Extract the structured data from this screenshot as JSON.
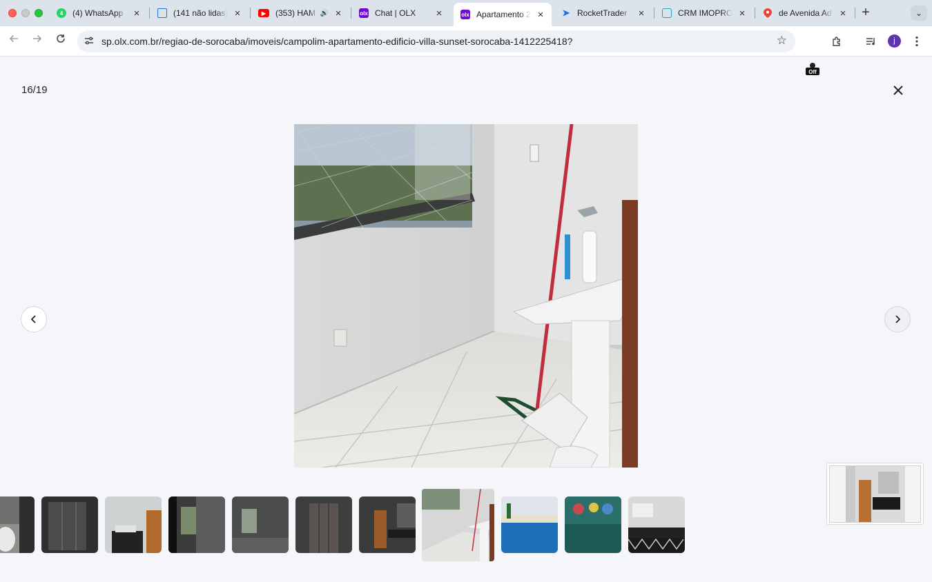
{
  "browser": {
    "tabs": [
      {
        "title": "(4) WhatsApp",
        "icon": "whatsapp-icon",
        "color": "#25d366"
      },
      {
        "title": "(141 não lidas)",
        "icon": "mail-icon",
        "color": "#1a73e8"
      },
      {
        "title": "(353) HAM",
        "icon": "youtube-icon",
        "color": "#ff0000"
      },
      {
        "title": "Chat | OLX",
        "icon": "olx-icon",
        "color": "#6e0ad6"
      },
      {
        "title": "Apartamento 2",
        "icon": "olx-icon",
        "color": "#6e0ad6"
      },
      {
        "title": "RocketTrader",
        "icon": "rocket-icon",
        "color": "#1a73e8"
      },
      {
        "title": "CRM IMOPRO",
        "icon": "crm-icon",
        "color": "#1aa6b7"
      },
      {
        "title": "de Avenida Ad",
        "icon": "maps-pin-icon",
        "color": "#ea4335"
      }
    ],
    "url": "sp.olx.com.br/regiao-de-sorocaba/imoveis/campolim-apartamento-edificio-villa-sunset-sorocaba-1412225418?",
    "extension_badge": "Off",
    "avatar_initial": "j"
  },
  "gallery": {
    "counter": "16/19"
  }
}
